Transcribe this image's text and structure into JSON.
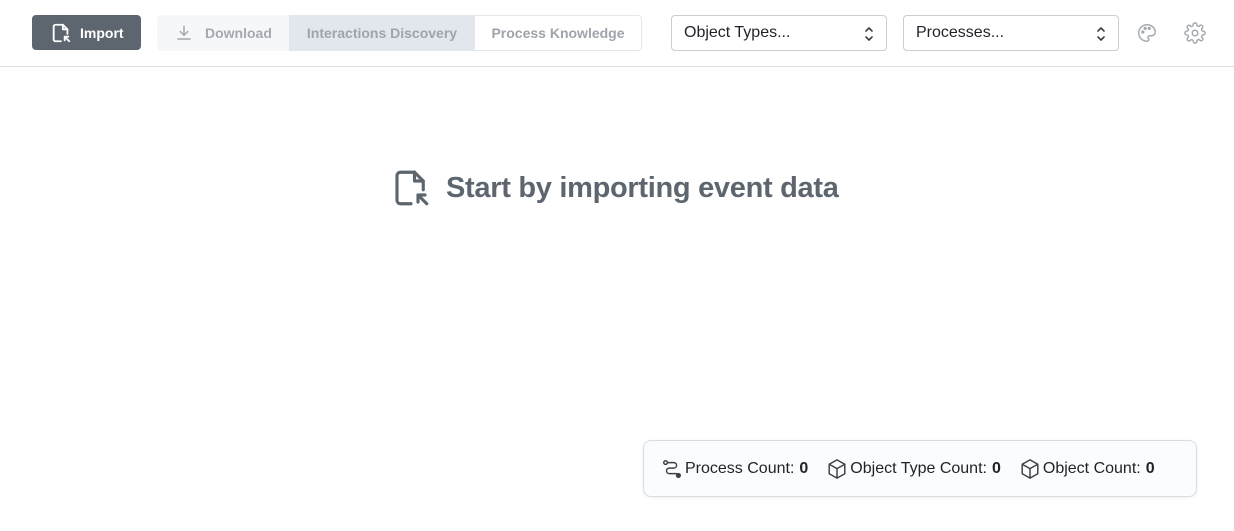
{
  "toolbar": {
    "import_label": "Import",
    "download_label": "Download",
    "tabs": [
      {
        "label": "Interactions Discovery",
        "active": true
      },
      {
        "label": "Process Knowledge",
        "active": false
      }
    ],
    "object_types_select": {
      "value": "Object Types..."
    },
    "processes_select": {
      "value": "Processes..."
    },
    "icons": {
      "import": "file-import-icon",
      "download": "download-icon",
      "palette": "palette-icon",
      "settings": "gear-icon"
    }
  },
  "main": {
    "empty_state_text": "Start by importing event data",
    "empty_state_icon": "file-import-icon"
  },
  "stats": {
    "process_count_label": "Process Count:",
    "process_count": "0",
    "object_type_count_label": "Object Type Count:",
    "object_type_count": "0",
    "object_count_label": "Object Count:",
    "object_count": "0"
  },
  "colors": {
    "primary_button": "#5d656f",
    "active_tab": "#e2e7ed",
    "muted_text": "#9ea4ab",
    "heading": "#5d656f"
  }
}
